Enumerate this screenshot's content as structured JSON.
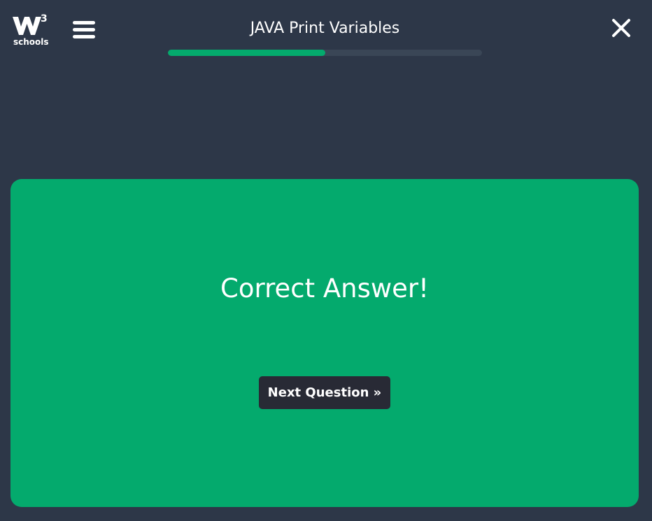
{
  "header": {
    "logo": {
      "superscript": "3",
      "wordmark": "schools",
      "icon": "w3schools-logo-icon"
    },
    "menu_icon": "hamburger-menu-icon",
    "title": "JAVA Print Variables",
    "progress": {
      "fraction": 0.5,
      "fill_color": "#04aa6d",
      "track_color": "#3a4656"
    },
    "close_icon": "close-x-icon"
  },
  "result": {
    "message": "Correct Answer!",
    "next_button_label": "Next Question »",
    "card_color": "#04aa6d"
  },
  "colors": {
    "background": "#2d3748",
    "accent": "#04aa6d",
    "button": "#282a35"
  }
}
